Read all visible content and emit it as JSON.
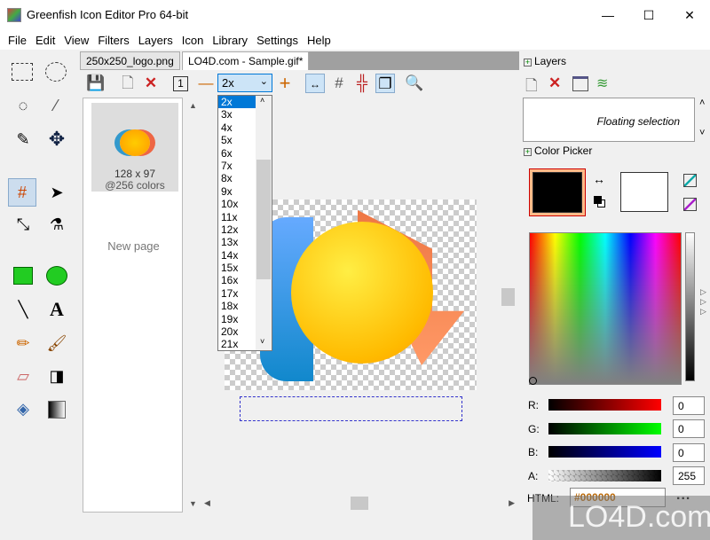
{
  "window": {
    "title": "Greenfish Icon Editor Pro 64-bit",
    "minimize": "—",
    "maximize": "☐",
    "close": "✕"
  },
  "menu": [
    "File",
    "Edit",
    "View",
    "Filters",
    "Layers",
    "Icon",
    "Library",
    "Settings",
    "Help"
  ],
  "tabs": [
    {
      "label": "250x250_logo.png",
      "active": false
    },
    {
      "label": "LO4D.com - Sample.gif*",
      "active": true
    }
  ],
  "toolbar": {
    "zoom_value": "2x",
    "zoom_minus": "—",
    "zoom_plus": "+"
  },
  "zoom_options": [
    "2x",
    "3x",
    "4x",
    "5x",
    "6x",
    "7x",
    "8x",
    "9x",
    "10x",
    "11x",
    "12x",
    "13x",
    "14x",
    "15x",
    "16x",
    "17x",
    "18x",
    "19x",
    "20x",
    "21x"
  ],
  "pages": {
    "thumb_size": "128 x 97",
    "thumb_colors": "@256 colors",
    "new_page": "New page"
  },
  "layers": {
    "title": "Layers",
    "items": [
      "Floating selection"
    ]
  },
  "color_picker": {
    "title": "Color Picker",
    "primary": "#000000",
    "secondary": "#ffffff",
    "r_label": "R:",
    "g_label": "G:",
    "b_label": "B:",
    "a_label": "A:",
    "r": "0",
    "g": "0",
    "b": "0",
    "a": "255",
    "html_label": "HTML:",
    "html_value": "#000000",
    "more": "..."
  },
  "watermark": "LO4D.com"
}
